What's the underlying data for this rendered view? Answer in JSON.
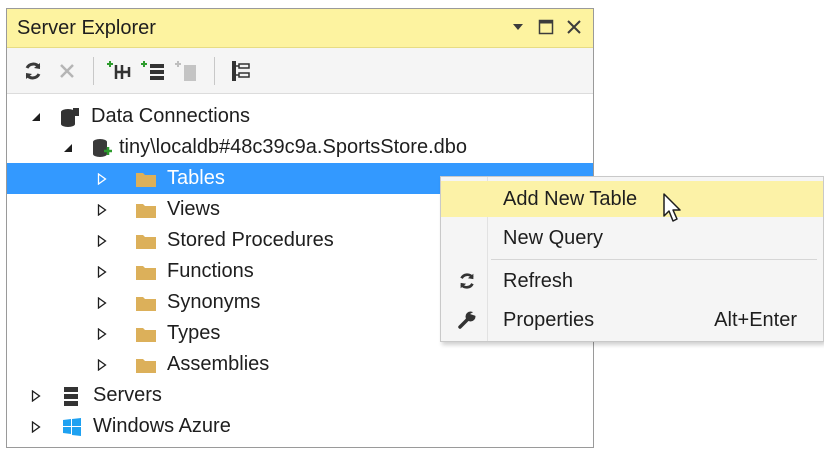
{
  "panel": {
    "title": "Server Explorer",
    "window_buttons": [
      "dropdown-arrow-icon",
      "maximize-icon",
      "close-icon"
    ]
  },
  "toolbar": {
    "tools": [
      "refresh-icon",
      "stop-icon",
      "connect-to-database-icon",
      "connect-to-server-icon",
      "connect-to-sharepoint-icon",
      "properties-icon"
    ]
  },
  "tree": {
    "data_connections": "Data Connections",
    "connection": "tiny\\localdb#48c39c9a.SportsStore.dbo",
    "items": [
      "Tables",
      "Views",
      "Stored Procedures",
      "Functions",
      "Synonyms",
      "Types",
      "Assemblies"
    ],
    "servers": "Servers",
    "azure": "Windows Azure",
    "selected": "Tables"
  },
  "context_menu": {
    "add_new_table": "Add New Table",
    "new_query": "New Query",
    "refresh": "Refresh",
    "properties": "Properties",
    "properties_shortcut": "Alt+Enter"
  },
  "colors": {
    "title_bar": "#fdf3a0",
    "selection": "#3399ff",
    "menu_highlight": "#fcf2a7",
    "folder": "#dcb05a"
  }
}
